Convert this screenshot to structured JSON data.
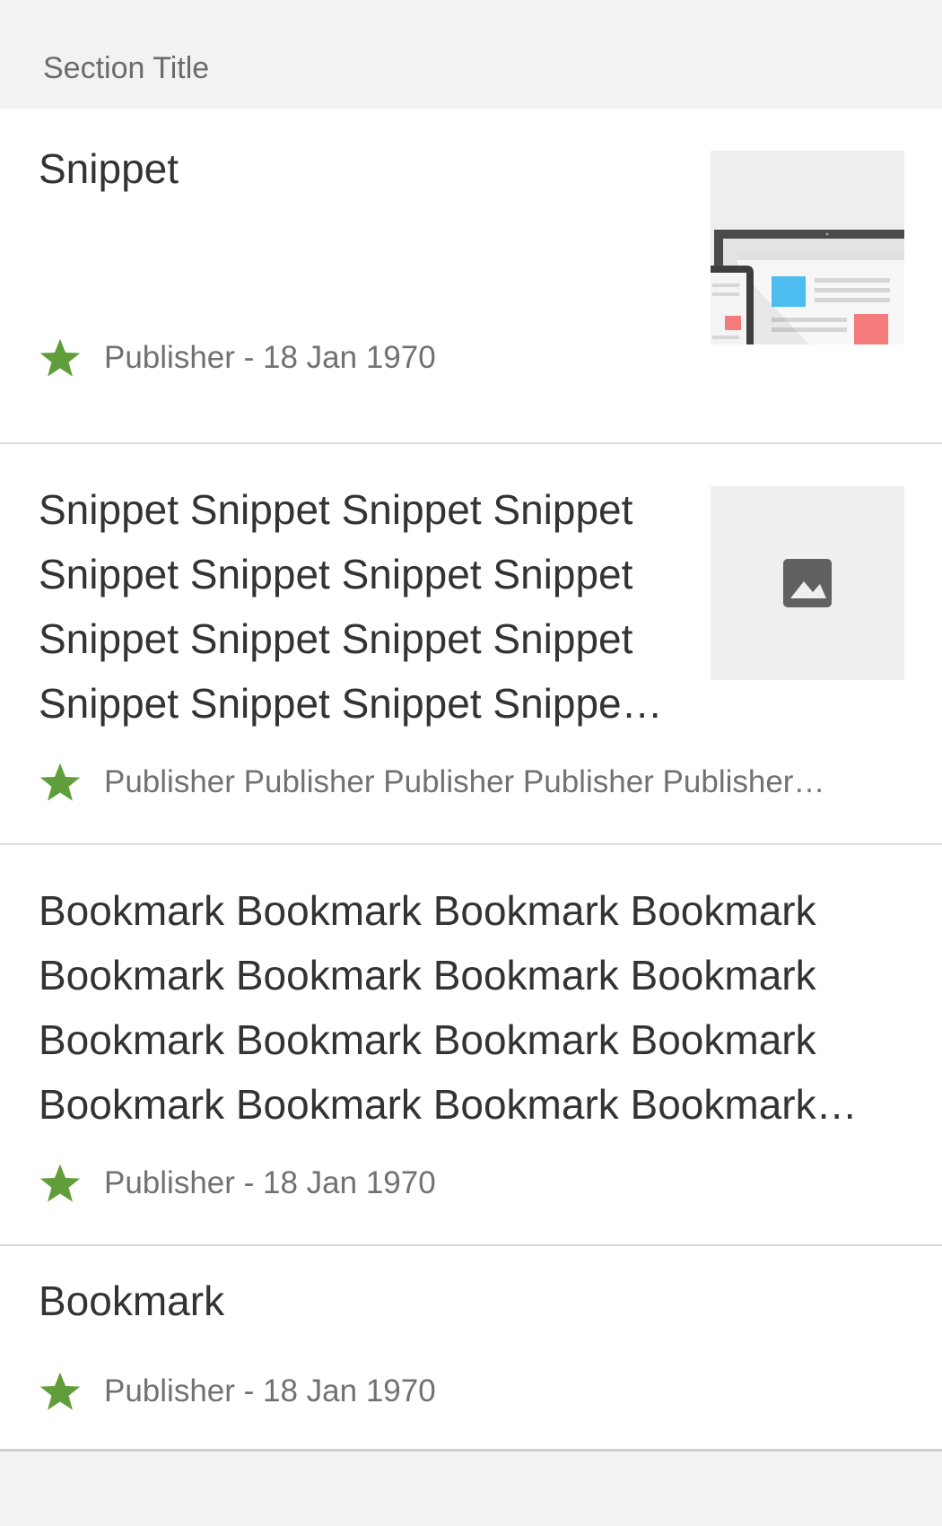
{
  "section": {
    "title": "Section Title"
  },
  "cards": [
    {
      "headline_lines": [
        "Snippet"
      ],
      "meta": "Publisher - 18 Jan 1970",
      "thumbnail": "article-illustration-thumbnail",
      "offline_badge": "star-icon"
    },
    {
      "headline_lines": [
        "Snippet Snippet Snippet Snippet",
        "Snippet Snippet Snippet Snippet",
        "Snippet Snippet Snippet Snippet",
        "Snippet Snippet Snippet Snippe…"
      ],
      "meta": "Publisher Publisher Publisher Publisher Publisher…",
      "thumbnail": "image-placeholder-icon",
      "offline_badge": "star-icon"
    },
    {
      "headline_lines": [
        "Bookmark Bookmark Bookmark Bookmark",
        "Bookmark Bookmark Bookmark Bookmark",
        "Bookmark Bookmark Bookmark Bookmark",
        "Bookmark Bookmark Bookmark Bookmark…"
      ],
      "meta": "Publisher - 18 Jan 1970",
      "offline_badge": "star-icon"
    },
    {
      "headline_lines": [
        "Bookmark"
      ],
      "meta": "Publisher - 18 Jan 1970",
      "offline_badge": "star-icon"
    }
  ],
  "colors": {
    "star": "#5f9e3a",
    "headline": "#333333",
    "meta": "#717171",
    "background": "#f2f2f2",
    "thumb_bg": "#efefef"
  }
}
